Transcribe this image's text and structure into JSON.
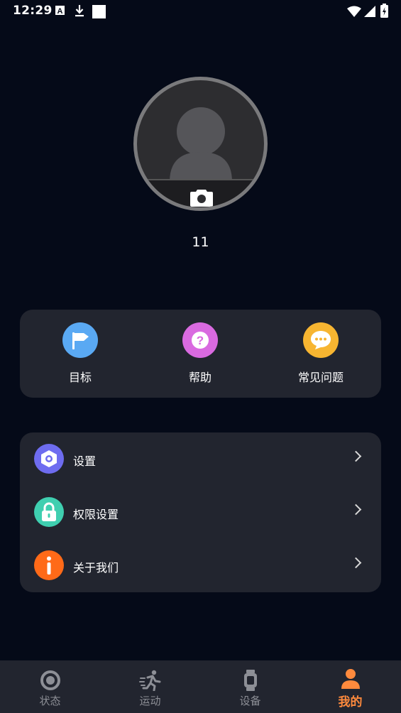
{
  "status_bar": {
    "time": "12:29"
  },
  "profile": {
    "username": "11"
  },
  "quick_actions": [
    {
      "label": "目标",
      "icon": "flag-icon",
      "color": "#5aa9f3"
    },
    {
      "label": "帮助",
      "icon": "question-icon",
      "color": "#d96ae0"
    },
    {
      "label": "常见问题",
      "icon": "chat-bubble-icon",
      "color": "#f7b531"
    }
  ],
  "menu": [
    {
      "label": "设置",
      "icon": "settings-hexagon-icon",
      "color": "#6e6cf0"
    },
    {
      "label": "权限设置",
      "icon": "lock-icon",
      "color": "#3fcfb0"
    },
    {
      "label": "关于我们",
      "icon": "info-icon",
      "color": "#ff6a18"
    }
  ],
  "nav": [
    {
      "label": "状态",
      "icon": "status-ring-icon",
      "active": false
    },
    {
      "label": "运动",
      "icon": "running-icon",
      "active": false
    },
    {
      "label": "设备",
      "icon": "watch-icon",
      "active": false
    },
    {
      "label": "我的",
      "icon": "person-icon",
      "active": true
    }
  ],
  "colors": {
    "background": "#050a18",
    "card": "#22252f",
    "accent": "#ff8a3d",
    "inactive": "#8d8f96"
  }
}
